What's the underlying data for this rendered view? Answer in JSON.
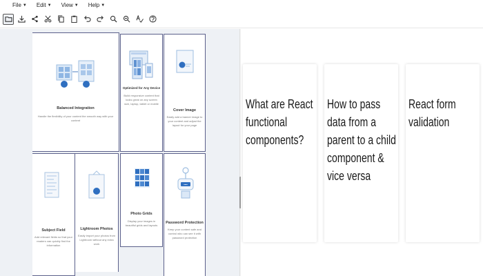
{
  "menubar": {
    "items": [
      {
        "label": "File"
      },
      {
        "label": "Edit"
      },
      {
        "label": "View"
      },
      {
        "label": "Help"
      }
    ]
  },
  "toolbar": {
    "icons": [
      "open-folder-icon",
      "download-icon",
      "share-icon",
      "cut-icon",
      "copy-icon",
      "paste-icon",
      "undo-icon",
      "redo-icon",
      "zoom-in-icon",
      "zoom-out-icon",
      "spellcheck-icon",
      "help-icon"
    ]
  },
  "tiles": {
    "t1": {
      "title": "Balanced Integration",
      "desc": "Handle the flexibility of your content the smooth way with your content"
    },
    "t2": {
      "title": "Optimized for Any Device",
      "desc": "Build responsive content that looks great on any screen size, laptop, tablet or mobile"
    },
    "t3": {
      "title": "Cover Image",
      "desc": "Easily add a banner image to your content and adjust the layout for your page"
    },
    "t4": {
      "title": "Subject Field",
      "desc": "Add relevant fields so that your readers can quickly find the information"
    },
    "t5": {
      "title": "Lightroom Photos",
      "desc": "Easily import your photos from Lightroom without any extra work"
    },
    "t6": {
      "title": "Photo Grids",
      "desc": "Display your images in beautiful grids and layouts"
    },
    "t7": {
      "title": "Password Protection",
      "desc": "Keep your content safe and control who can see it with password protection"
    }
  },
  "cards": [
    {
      "title": "What are React functional components?"
    },
    {
      "title": "How to pass data from a parent to a child component & vice versa"
    },
    {
      "title": "React form validation"
    }
  ]
}
